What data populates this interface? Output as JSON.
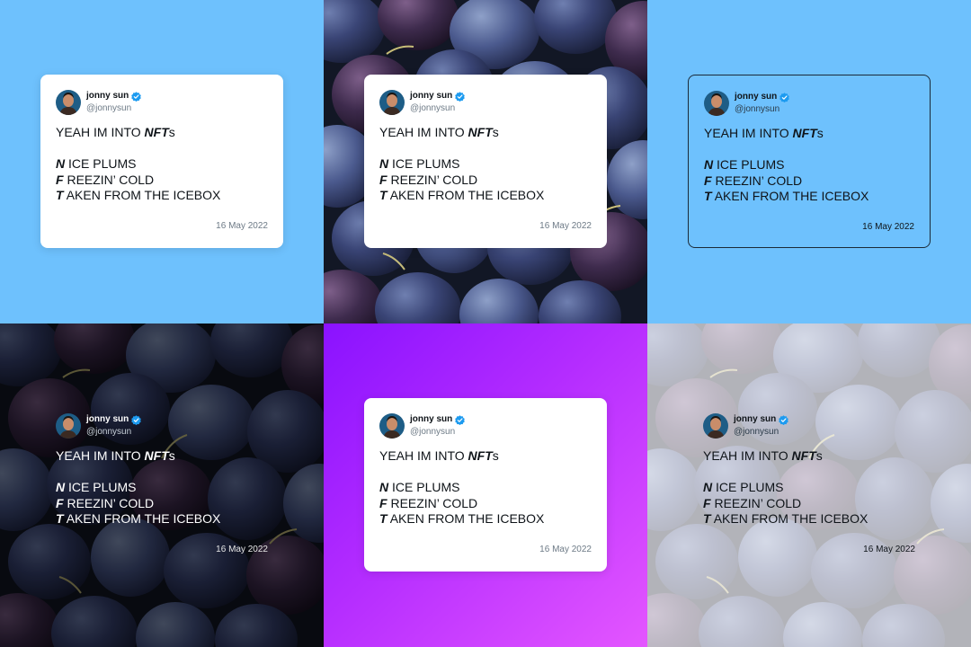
{
  "tweet": {
    "name": "jonny sun",
    "handle": "@jonnysun",
    "line1_pre": "YEAH IM INTO ",
    "line1_bold": "NFT",
    "line1_post": "s",
    "line2_bold": "N",
    "line2_rest": "ICE PLUMS",
    "line3_bold": "F",
    "line3_rest": "REEZIN’ COLD",
    "line4_bold": "T",
    "line4_rest": "AKEN FROM THE ICEBOX",
    "date": "16 May 2022"
  },
  "icons": {
    "verified": "verified-badge-icon",
    "avatar": "profile-photo"
  },
  "colors": {
    "sky_blue": "#6ec1fd",
    "gradient_start": "#8a12ff",
    "gradient_end": "#e456ff",
    "verified_blue": "#1d9bf0",
    "card_white": "#ffffff"
  },
  "variants": [
    {
      "background": "light blue",
      "card": "white"
    },
    {
      "background": "plums photo",
      "card": "white"
    },
    {
      "background": "light blue",
      "card": "outlined"
    },
    {
      "background": "darkened plums photo",
      "card": "transparent"
    },
    {
      "background": "purple gradient",
      "card": "white"
    },
    {
      "background": "faded plums photo",
      "card": "transparent"
    }
  ]
}
